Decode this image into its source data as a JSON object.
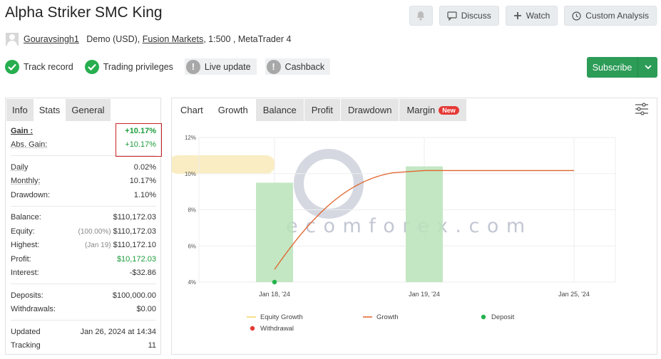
{
  "title": "Alpha Striker SMC King",
  "actions": {
    "discuss": "Discuss",
    "watch": "Watch",
    "custom": "Custom Analysis"
  },
  "account": {
    "user": "Gouravsingh1",
    "type": "Demo (USD),",
    "broker": "Fusion Markets",
    "rest": ", 1:500 , MetaTrader 4"
  },
  "badges": [
    {
      "label": "Track record",
      "state": "ok"
    },
    {
      "label": "Trading privileges",
      "state": "ok"
    },
    {
      "label": "Live update",
      "state": "warn"
    },
    {
      "label": "Cashback",
      "state": "warn"
    }
  ],
  "subscribe": "Subscribe",
  "left_tabs": [
    "Info",
    "Stats",
    "General"
  ],
  "stats": {
    "gain": {
      "label": "Gain :",
      "value": "+10.17%"
    },
    "abs_gain": {
      "label": "Abs. Gain:",
      "value": "+10.17%"
    },
    "daily": {
      "label": "Daily",
      "value": "0.02%"
    },
    "monthly": {
      "label": "Monthly:",
      "value": "10.17%"
    },
    "drawdown": {
      "label": "Drawdown:",
      "value": "1.10%"
    },
    "balance": {
      "label": "Balance:",
      "value": "$110,172.03"
    },
    "equity": {
      "label": "Equity:",
      "prefix": "(100.00%)",
      "value": "$110,172.03"
    },
    "highest": {
      "label": "Highest:",
      "prefix": "(Jan 19)",
      "value": "$110,172.10"
    },
    "profit": {
      "label": "Profit:",
      "value": "$10,172.03"
    },
    "interest": {
      "label": "Interest:",
      "value": "-$32.86"
    },
    "deposits": {
      "label": "Deposits:",
      "value": "$100,000.00"
    },
    "withdrawals": {
      "label": "Withdrawals:",
      "value": "$0.00"
    },
    "updated": {
      "label": "Updated",
      "value": "Jan 26, 2024 at 14:34"
    },
    "tracking": {
      "label": "Tracking",
      "value": "11"
    }
  },
  "chart_tabs": {
    "chart": "Chart",
    "growth": "Growth",
    "balance": "Balance",
    "profit": "Profit",
    "drawdown": "Drawdown",
    "margin": "Margin",
    "new_badge": "New"
  },
  "watermark": {
    "text": "ecomforex.com"
  },
  "colors": {
    "accent_green": "#2c9c57",
    "gain_green": "#1d9c3b",
    "growth_line": "#e0632a",
    "equity_line": "#f2d36b",
    "bar": "#b9e3b8",
    "deposit": "#22b24c",
    "withdrawal": "#e53935"
  },
  "chart_data": {
    "type": "line",
    "x": [
      "Jan 18, '24",
      "Jan 18, '24",
      "Jan 19, '24",
      "Jan 25, '24"
    ],
    "x_ticks": [
      "Jan 18, '24",
      "Jan 19, '24",
      "Jan 25, '24"
    ],
    "y_ticks": [
      "12%",
      "10%",
      "8%",
      "6%",
      "4%"
    ],
    "ylim": [
      4,
      12
    ],
    "series": [
      {
        "name": "Growth",
        "values": [
          4.7,
          7.6,
          10.17,
          10.17
        ]
      }
    ],
    "bars": [
      {
        "x": "Jan 18, '24",
        "value": 9.5
      },
      {
        "x": "Jan 19, '24",
        "value": 10.4
      }
    ],
    "deposits": [
      {
        "x": "Jan 18, '24",
        "value": 4.0
      }
    ],
    "legend": [
      "Equity Growth",
      "Growth",
      "Deposit",
      "Withdrawal"
    ]
  }
}
